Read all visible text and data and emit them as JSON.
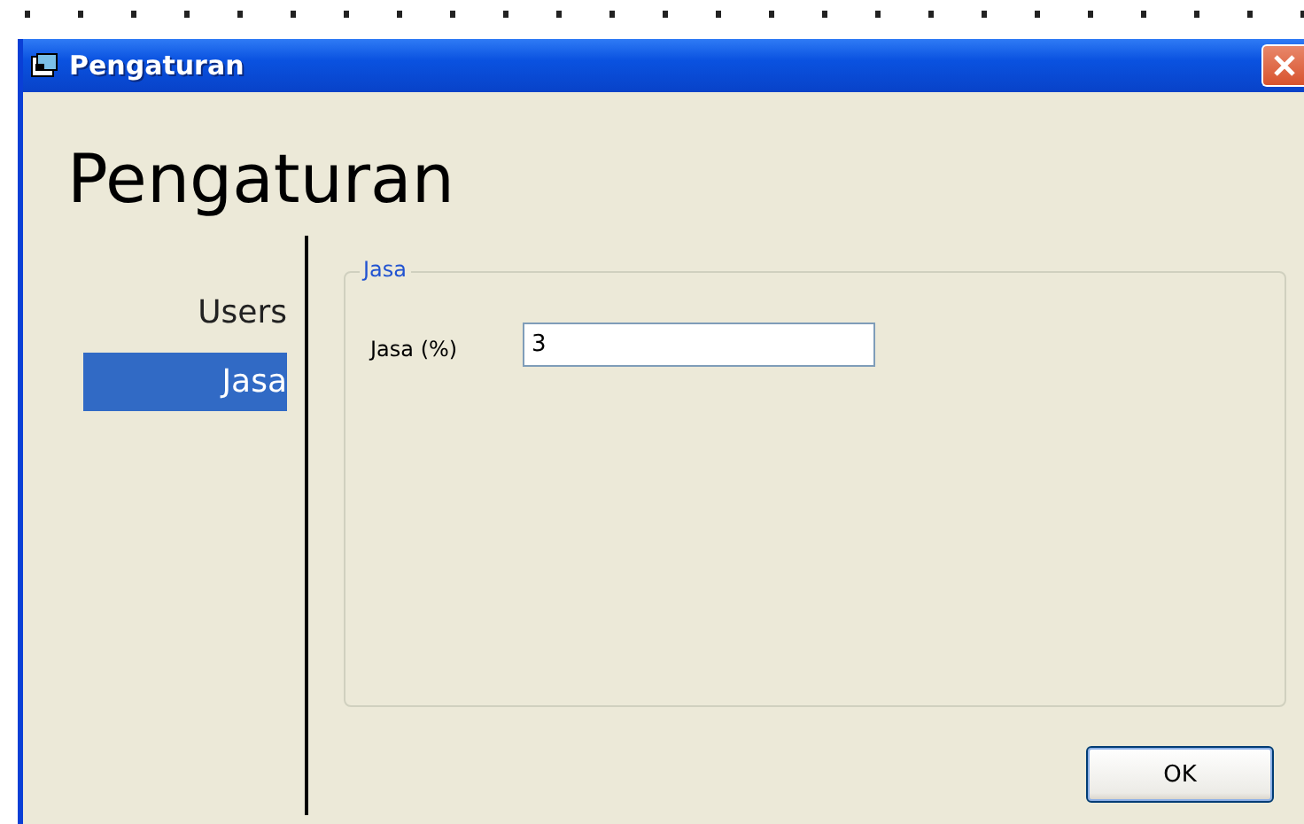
{
  "window": {
    "title": "Pengaturan"
  },
  "heading": "Pengaturan",
  "sidebar": {
    "items": [
      {
        "label": "Users",
        "selected": false
      },
      {
        "label": "Jasa",
        "selected": true
      }
    ]
  },
  "group": {
    "title": "Jasa",
    "fields": [
      {
        "label": "Jasa (%)",
        "value": "3"
      }
    ]
  },
  "buttons": [
    "OK"
  ]
}
